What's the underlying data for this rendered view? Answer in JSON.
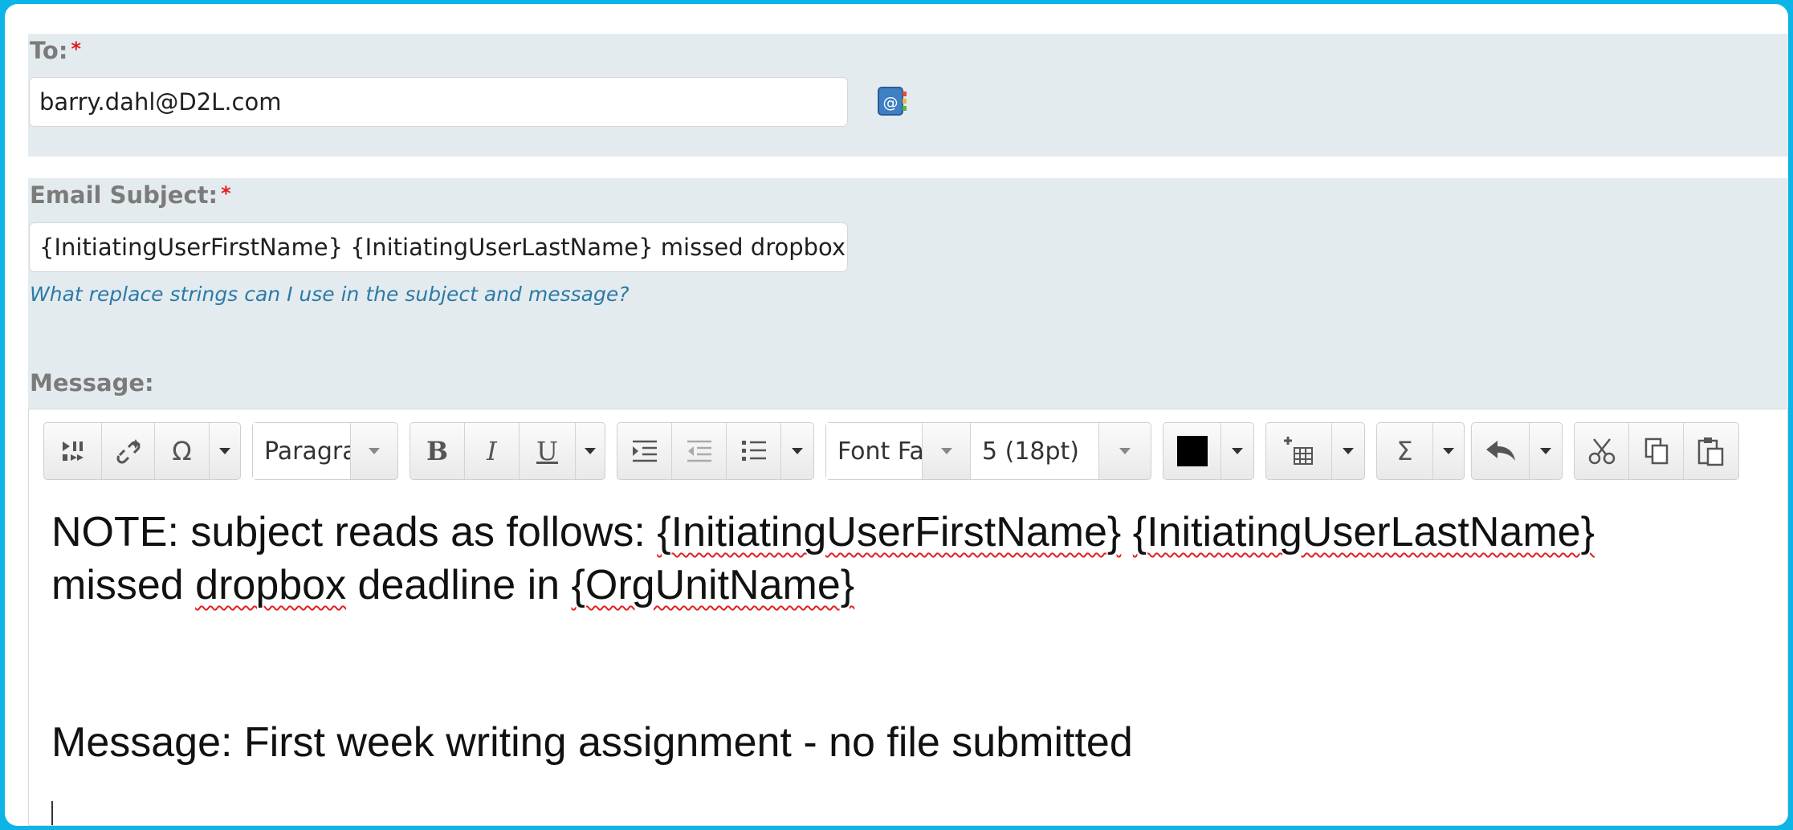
{
  "to": {
    "label": "To:",
    "required": "*",
    "value": "barry.dahl@D2L.com",
    "addr_book_icon": "address-book-icon"
  },
  "subject": {
    "label": "Email Subject:",
    "required": "*",
    "value": "{InitiatingUserFirstName} {InitiatingUserLastName} missed dropbox deadline in {OrgUnitName}",
    "help_link": "What replace strings can I use in the subject and message?"
  },
  "message": {
    "label": "Message:",
    "toolbar": {
      "paragraph_select": "Paragraph",
      "font_family_select": "Font Family",
      "font_size_select": "5 (18pt)",
      "text_color": "#000000",
      "omega_glyph": "Ω",
      "sigma_glyph": "Σ",
      "bold": "B",
      "italic": "I",
      "underline": "U"
    },
    "body": {
      "line1_plain1": "NOTE: subject reads as follows: ",
      "line1_word1": "{InitiatingUserFirstName}",
      "line1_space": " ",
      "line1_word2": "{InitiatingUserLastName}",
      "line2_plain1": "missed ",
      "line2_word1": "dropbox",
      "line2_plain2": " deadline in ",
      "line2_word2": "{OrgUnitName}",
      "line3": "Message: First week writing assignment - no file submitted"
    }
  },
  "colors": {
    "background": "#0db4e6",
    "panel": "#e4ebef",
    "link": "#2c7aa6",
    "required": "#e01e1e"
  }
}
